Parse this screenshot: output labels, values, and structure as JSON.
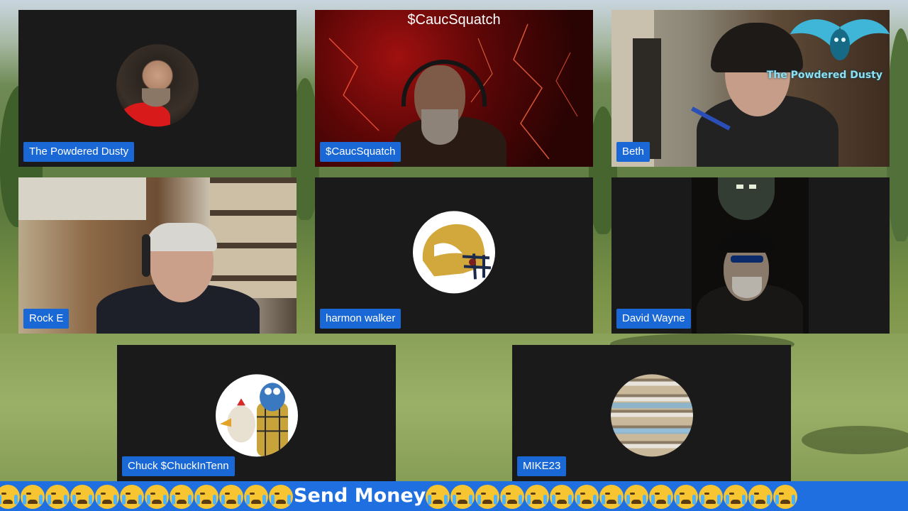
{
  "participants": [
    {
      "name": "The Powdered Dusty",
      "type": "avatar"
    },
    {
      "name": "$CaucSquatch",
      "type": "video",
      "overlay_title": "$CaucSquatch"
    },
    {
      "name": "Beth",
      "type": "video",
      "logo_text": "The Powdered Dusty"
    },
    {
      "name": "Rock E",
      "type": "video"
    },
    {
      "name": "harmon walker",
      "type": "avatar"
    },
    {
      "name": "David Wayne",
      "type": "video"
    },
    {
      "name": "Chuck $ChuckInTenn",
      "type": "avatar"
    },
    {
      "name": "MIKE23",
      "type": "avatar"
    }
  ],
  "ticker": {
    "text": "Send Money",
    "leading_emoji_count": 12,
    "trailing_emoji_count": 15,
    "emoji_icon": "loudly-crying-face-icon"
  },
  "colors": {
    "label_bg": "#1a68d6",
    "ticker_bg": "#1f6fe0",
    "tile_bg": "#1a1a1a"
  }
}
